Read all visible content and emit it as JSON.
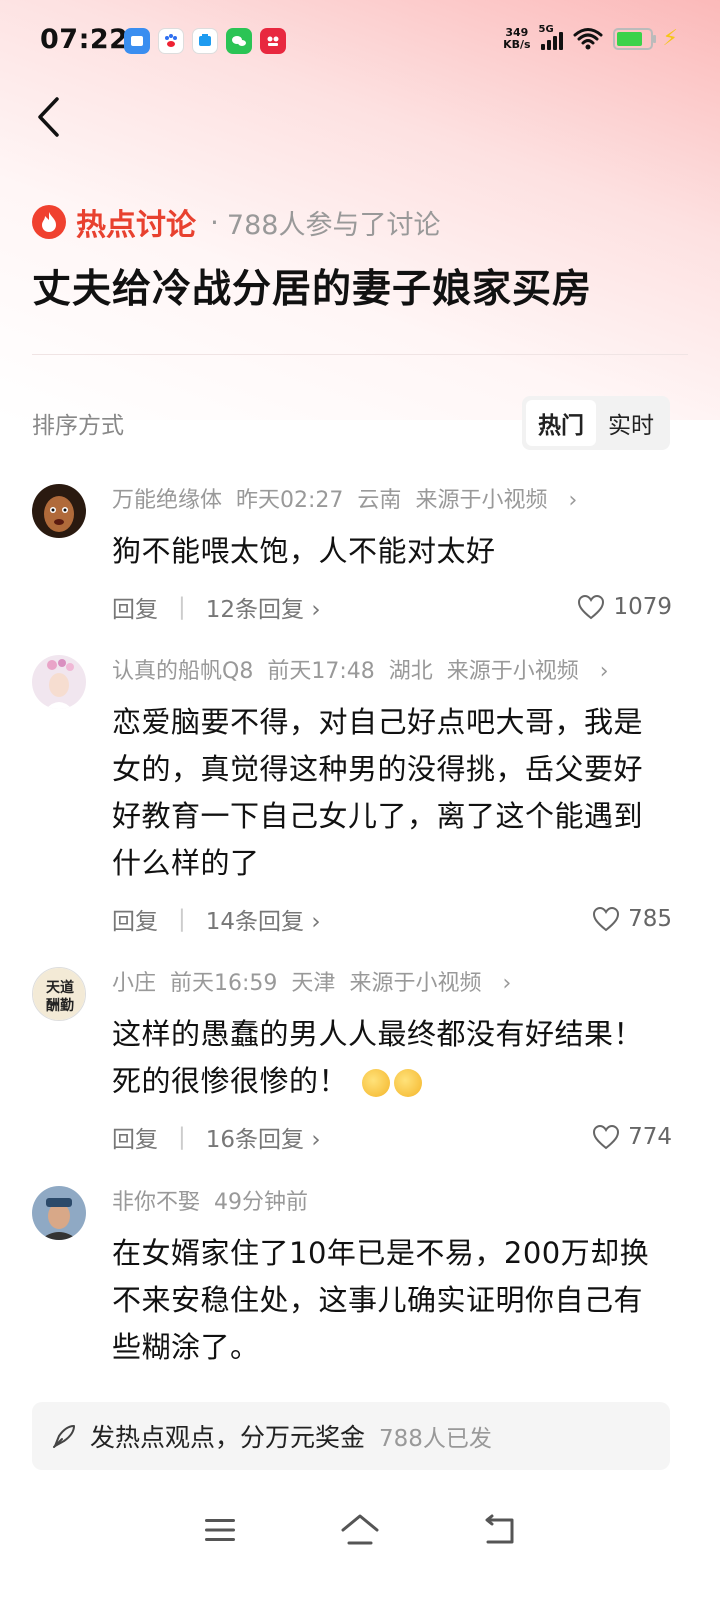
{
  "status_bar": {
    "time": "07:22",
    "net_speed_value": "349",
    "net_speed_unit": "KB/s",
    "network": "5G",
    "battery_percent": 0.78,
    "charging": true,
    "app_icons": [
      "note-app-icon",
      "baidu-app-icon",
      "message-app-icon",
      "wechat-app-icon",
      "red-app-icon"
    ]
  },
  "topic": {
    "tag": "热点讨论",
    "separator": "·",
    "participants": "788人参与了讨论",
    "title": "丈夫给冷战分居的妻子娘家买房"
  },
  "sort": {
    "label": "排序方式",
    "options": [
      "热门",
      "实时"
    ],
    "active": "热门"
  },
  "comments": [
    {
      "user": "万能绝缘体",
      "time": "昨天02:27",
      "location": "云南",
      "source": "来源于小视频",
      "text": "狗不能喂太饱，人不能对太好",
      "reply_label": "回复",
      "reply_count": "12条回复",
      "likes": "1079",
      "avatar_color": "#6b3a20"
    },
    {
      "user": "认真的船帆Q8",
      "time": "前天17:48",
      "location": "湖北",
      "source": "来源于小视频",
      "text": "恋爱脑要不得，对自己好点吧大哥，我是女的，真觉得这种男的没得挑，岳父要好好教育一下自己女儿了，离了这个能遇到什么样的了",
      "reply_label": "回复",
      "reply_count": "14条回复",
      "likes": "785",
      "avatar_color": "#e9d8e6"
    },
    {
      "user": "小庄",
      "time": "前天16:59",
      "location": "天津",
      "source": "来源于小视频",
      "text": "这样的愚蠢的男人人最终都没有好结果！死的很惨很惨的！",
      "reply_label": "回复",
      "reply_count": "16条回复",
      "likes": "774",
      "avatar_color": "#f3ead6",
      "avatar_text": "天道酬勤"
    },
    {
      "user": "非你不娶",
      "time": "49分钟前",
      "text": "在女婿家住了10年已是不易，200万却换不来安稳住处，这事儿确实证明你自己有些糊涂了。",
      "avatar_color": "#3d5a7a"
    }
  ],
  "post_bar": {
    "main": "发热点观点，分万元奖金",
    "sub": "788人已发"
  },
  "nav": [
    "menu-icon",
    "home-icon",
    "back-nav-icon"
  ]
}
